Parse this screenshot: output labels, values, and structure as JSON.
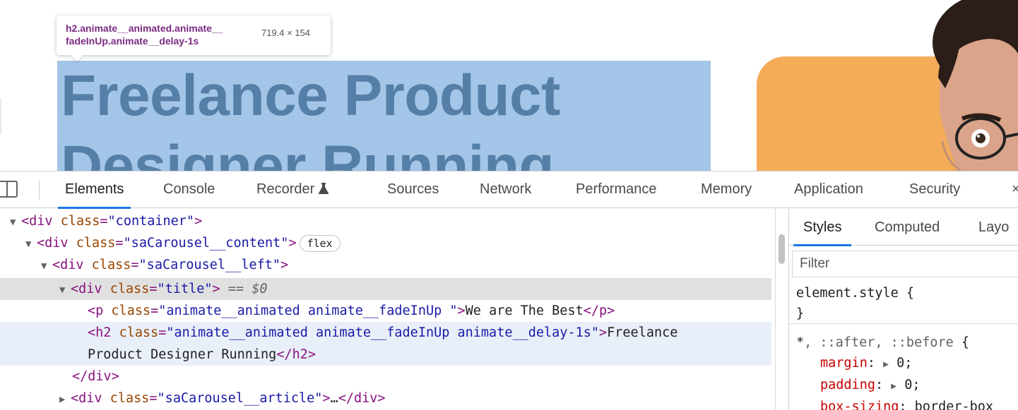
{
  "page": {
    "tooltip": {
      "selector_line1": "h2.animate__animated.animate__",
      "selector_line2": "fadeInUp.animate__delay-1s",
      "size": "719.4 × 154"
    },
    "hero_title": {
      "line1": "Freelance Product",
      "line2": "Designer Running"
    }
  },
  "colors": {
    "highlight": "#a3c6e8",
    "hero_text": "#557fa7",
    "orange": "#f4ac59",
    "accent": "#1a73e8"
  },
  "devtools": {
    "dock_icon": "dock-side-icon",
    "tabs": [
      {
        "label": "Elements"
      },
      {
        "label": "Console"
      },
      {
        "label": "Recorder"
      },
      {
        "label": "Sources"
      },
      {
        "label": "Network"
      },
      {
        "label": "Performance"
      },
      {
        "label": "Memory"
      },
      {
        "label": "Application"
      },
      {
        "label": "Security"
      }
    ],
    "more_label": "×",
    "elements": {
      "row0": {
        "tag_open": "<div ",
        "attr": "class",
        "val": "\"container\"",
        "tag_close": ">"
      },
      "row1": {
        "tag_open": "<div ",
        "attr": "class",
        "val": "\"saCarousel__content\"",
        "tag_close": ">",
        "badge": "flex"
      },
      "row2": {
        "tag_open": "<div ",
        "attr": "class",
        "val": "\"saCarousel__left\"",
        "tag_close": ">"
      },
      "row3": {
        "tag_open": "<div ",
        "attr": "class",
        "val": "\"title\"",
        "tag_close": ">",
        "eq": " == $0"
      },
      "row4": {
        "tag_open": "<p ",
        "attr": "class",
        "val": "\"animate__animated animate__fadeInUp \"",
        "tag_close": ">",
        "text": "We are The Best",
        "end_tag": "</p>"
      },
      "row5": {
        "tag_open": "<h2 ",
        "attr": "class",
        "val": "\"animate__animated animate__fadeInUp animate__delay-1s\"",
        "tag_close": ">",
        "text": "Freelance"
      },
      "row6": {
        "text": "Product Designer Running",
        "end_tag": "</h2>"
      },
      "row7": {
        "end_tag": "</div>"
      },
      "row8": {
        "tag_open": "<div ",
        "attr": "class",
        "val": "\"saCarousel__article\"",
        "tag_close": ">",
        "ellipsis": "…",
        "end_tag": "</div>"
      }
    },
    "styles": {
      "tabs": [
        {
          "label": "Styles"
        },
        {
          "label": "Computed"
        },
        {
          "label": "Layo"
        }
      ],
      "filter_placeholder": "Filter",
      "element_style_selector": "element.style",
      "open_brace": " {",
      "close_brace": "}",
      "rule_selector_star": "*",
      "rule_selector_rest": ", ::after, ::before",
      "decls": [
        {
          "prop": "margin",
          "value": "0;"
        },
        {
          "prop": "padding",
          "value": "0;"
        },
        {
          "prop": "box-sizing",
          "value": "border-box"
        }
      ]
    }
  }
}
